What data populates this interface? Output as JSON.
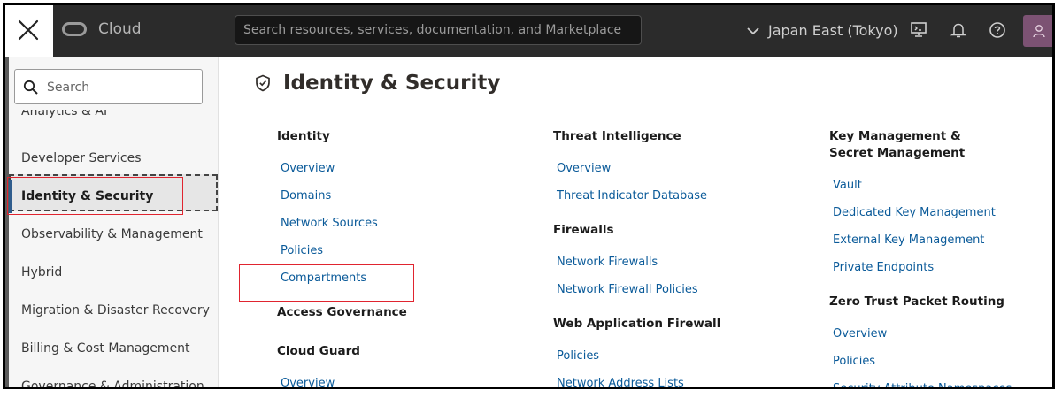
{
  "header": {
    "logo_text": "Cloud",
    "search_placeholder": "Search resources, services, documentation, and Marketplace",
    "region": "Japan East (Tokyo)",
    "icons": [
      "close-icon",
      "oracle-logo-icon",
      "chevron-down-icon",
      "cloud-shell-icon",
      "bell-icon",
      "help-icon",
      "user-icon"
    ]
  },
  "sidebar": {
    "search_placeholder": "Search",
    "items": [
      {
        "label": "Analytics & AI"
      },
      {
        "label": "Developer Services"
      },
      {
        "label": "Identity & Security",
        "active": true
      },
      {
        "label": "Observability & Management"
      },
      {
        "label": "Hybrid"
      },
      {
        "label": "Migration & Disaster Recovery"
      },
      {
        "label": "Billing & Cost Management"
      },
      {
        "label": "Governance & Administration"
      }
    ]
  },
  "main": {
    "title": "Identity & Security",
    "title_icon": "shield-check-icon",
    "col1": {
      "identity": {
        "title": "Identity",
        "links": [
          "Overview",
          "Domains",
          "Network Sources",
          "Policies",
          "Compartments"
        ]
      },
      "access_governance": {
        "title": "Access Governance"
      },
      "cloud_guard": {
        "title": "Cloud Guard",
        "links": [
          "Overview"
        ]
      }
    },
    "col2": {
      "threat_intelligence": {
        "title": "Threat Intelligence",
        "links": [
          "Overview",
          "Threat Indicator Database"
        ]
      },
      "firewalls": {
        "title": "Firewalls",
        "links": [
          "Network Firewalls",
          "Network Firewall Policies"
        ]
      },
      "waf": {
        "title": "Web Application Firewall",
        "links": [
          "Policies",
          "Network Address Lists"
        ]
      }
    },
    "col3": {
      "kms": {
        "title": "Key Management & Secret Management",
        "links": [
          "Vault",
          "Dedicated Key Management",
          "External Key Management",
          "Private Endpoints"
        ]
      },
      "zpr": {
        "title": "Zero Trust Packet Routing",
        "links": [
          "Overview",
          "Policies",
          "Security Attribute Namespaces"
        ]
      }
    }
  },
  "colors": {
    "topbar": "#2b2b2b",
    "link": "#0a5a99",
    "highlight": "#e0242f",
    "accent_bar": "#2f5c8c",
    "avatar": "#7c5273"
  }
}
